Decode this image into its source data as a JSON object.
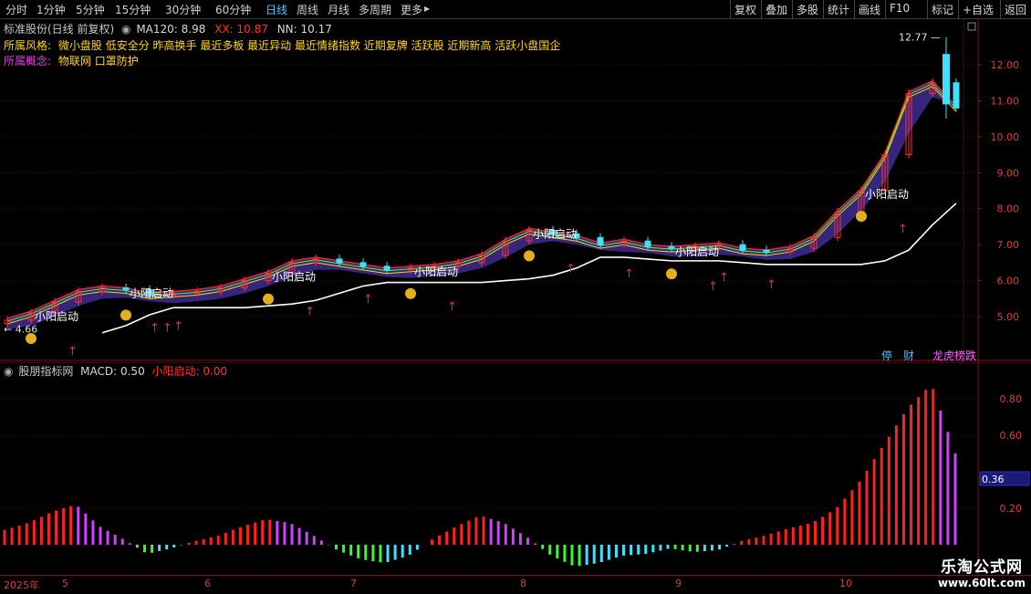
{
  "toolbar": {
    "left_items": [
      "分时",
      "1分钟",
      "5分钟",
      "15分钟",
      "30分钟",
      "60分钟",
      "日线",
      "周线",
      "月线",
      "多周期",
      "更多"
    ],
    "active": "日线",
    "right_items": [
      "复权",
      "叠加",
      "多股",
      "统计",
      "画线",
      "F10",
      "标记",
      "+自选",
      "返回"
    ]
  },
  "header": {
    "stock": "标准股份(日线 前复权)",
    "ma120_label": "MA120: 8.98",
    "xx_label": "XX: 10.87",
    "nn_label": "NN: 10.17",
    "style_label": "所属风格:",
    "style_text": "微小盘股 低安全分 昨高换手 最近多板 最近异动 最近情绪指数 近期复牌 活跃股 近期新高 活跃小盘国企",
    "concept_label": "所属概念:",
    "concept_text": "物联网 口罩防护"
  },
  "main_chart": {
    "y_ticks": [
      "12.00",
      "11.00",
      "10.00",
      "9.00",
      "8.00",
      "7.00",
      "6.00",
      "5.00"
    ],
    "high_label": "12.77",
    "low_label": "4.66",
    "signal_label": "小阳启动",
    "badges": [
      "停",
      "财",
      "龙虎榜跌"
    ]
  },
  "macd_panel": {
    "title": "股朋指标网",
    "macd_label": "MACD: 0.50",
    "signal_label": "小阳启动: 0.00",
    "y_ticks": [
      "0.80",
      "0.60",
      "0.36",
      "0.20"
    ]
  },
  "x_axis": {
    "labels": [
      "2025年",
      "5",
      "6",
      "7",
      "8",
      "9",
      "10"
    ]
  },
  "logo": {
    "title": "乐淘公式网",
    "url": "www.60lt.com"
  },
  "colors": {
    "up": "#ff3030",
    "down": "#40e0ff",
    "axis": "#8a1010",
    "macd_pos": "#ff2020",
    "macd_neg": "#30ff30",
    "macd_purple": "#d040ff",
    "macd_cyan": "#40e0ff"
  },
  "chart_data": {
    "type": "line",
    "y_ticks": [
      12.0,
      11.0,
      10.0,
      9.0,
      8.0,
      7.0,
      6.0,
      5.0
    ],
    "price_high": 12.77,
    "price_low": 4.66,
    "close_series": [
      4.9,
      5.1,
      5.4,
      5.7,
      5.8,
      5.75,
      5.6,
      5.65,
      5.7,
      5.8,
      6.0,
      6.2,
      6.5,
      6.6,
      6.5,
      6.4,
      6.3,
      6.35,
      6.4,
      6.5,
      6.7,
      7.1,
      7.4,
      7.3,
      7.2,
      7.0,
      7.1,
      6.95,
      6.9,
      6.95,
      7.0,
      6.85,
      6.8,
      6.9,
      7.2,
      7.9,
      8.5,
      9.5,
      11.2,
      11.5,
      10.8
    ],
    "macd_values": [
      0.08,
      0.12,
      0.18,
      0.22,
      0.1,
      0.03,
      -0.05,
      -0.02,
      0.02,
      0.05,
      0.1,
      0.14,
      0.12,
      0.05,
      -0.03,
      -0.08,
      -0.1,
      -0.06,
      0.03,
      0.1,
      0.16,
      0.12,
      0.04,
      -0.06,
      -0.12,
      -0.1,
      -0.06,
      -0.05,
      -0.02,
      -0.04,
      -0.03,
      0.02,
      0.05,
      0.09,
      0.12,
      0.2,
      0.35,
      0.55,
      0.75,
      0.88,
      0.5
    ],
    "macd_ylim": [
      0,
      0.9
    ]
  }
}
